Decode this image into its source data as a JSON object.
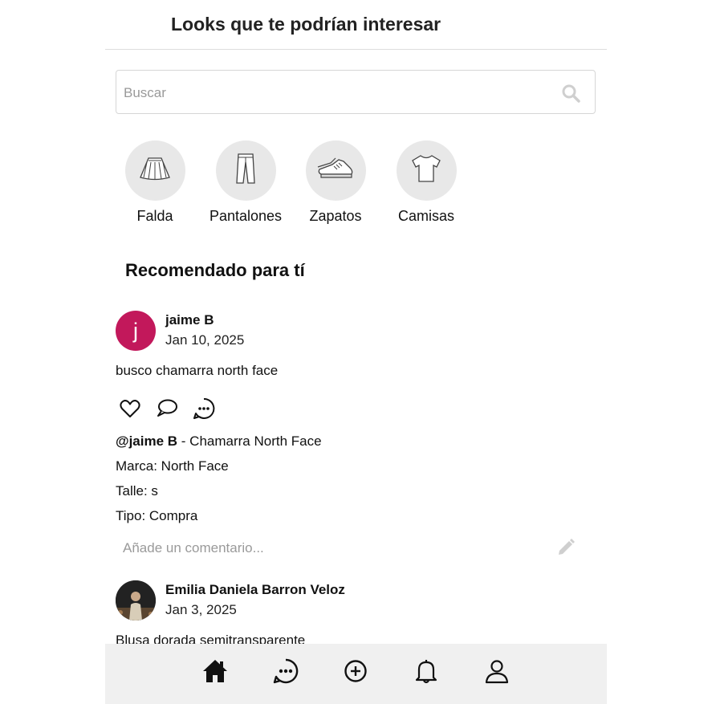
{
  "header": {
    "title": "Looks que te podrían interesar"
  },
  "search": {
    "placeholder": "Buscar",
    "icon": "search-icon"
  },
  "categories": [
    {
      "label": "Falda",
      "icon": "skirt-icon"
    },
    {
      "label": "Pantalones",
      "icon": "pants-icon"
    },
    {
      "label": "Zapatos",
      "icon": "sneaker-icon"
    },
    {
      "label": "Camisas",
      "icon": "tshirt-icon"
    }
  ],
  "section": {
    "title": "Recomendado para tí"
  },
  "posts": [
    {
      "avatar_initial": "j",
      "avatar_color": "#c2185b",
      "username": "jaime B",
      "date": "Jan 10, 2025",
      "text": "busco chamarra north face",
      "mention": "@jaime B",
      "title_suffix": " - Chamarra North Face",
      "brand": "Marca: North Face",
      "size": "Talle: s",
      "type": "Tipo: Compra",
      "comment_placeholder": "Añade un comentario..."
    },
    {
      "username": "Emilia Daniela Barron Veloz",
      "date": "Jan 3, 2025",
      "text": "Blusa dorada semitransparente"
    }
  ],
  "bottom_nav": [
    "home-icon",
    "chat-icon",
    "add-icon",
    "bell-icon",
    "profile-icon"
  ]
}
